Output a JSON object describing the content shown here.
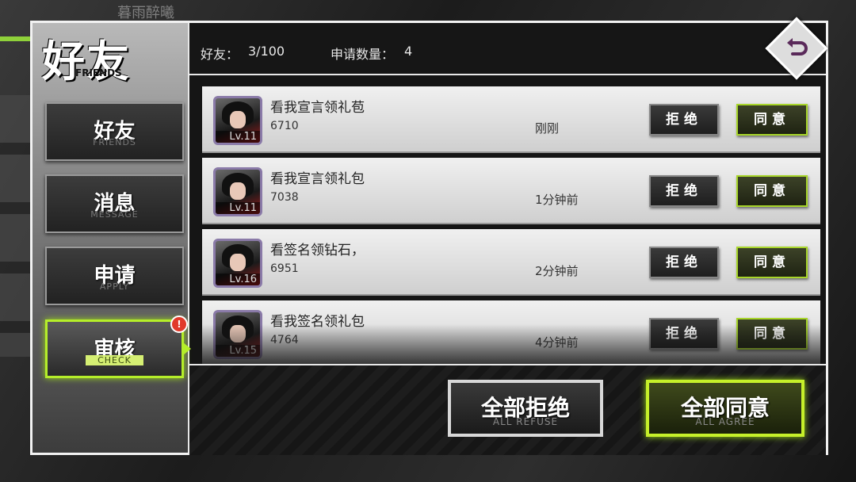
{
  "background": {
    "title": "暮雨醉曦"
  },
  "panel": {
    "title": "好友",
    "subtitle": "FRIENDS"
  },
  "nav": [
    {
      "label": "好友",
      "en": "FRIENDS",
      "active": false
    },
    {
      "label": "消息",
      "en": "MESSAGE",
      "active": false
    },
    {
      "label": "申请",
      "en": "APPLY",
      "active": false
    },
    {
      "label": "审核",
      "en": "CHECK",
      "active": true,
      "badge": "!"
    }
  ],
  "header": {
    "friends_label": "好友：",
    "friends_count": "3/100",
    "requests_label": "申请数量：",
    "requests_count": "4"
  },
  "requests": [
    {
      "name": "看我宣言领礼苞",
      "uid": "6710",
      "time": "刚刚",
      "level": "Lv.11"
    },
    {
      "name": "看我宣言领礼包",
      "uid": "7038",
      "time": "1分钟前",
      "level": "Lv.11"
    },
    {
      "name": "看签名领钻石，",
      "uid": "6951",
      "time": "2分钟前",
      "level": "Lv.16"
    },
    {
      "name": "看我签名领礼包",
      "uid": "4764",
      "time": "4分钟前",
      "level": "Lv.15"
    }
  ],
  "row_buttons": {
    "refuse": "拒绝",
    "agree": "同意"
  },
  "footer": {
    "refuse_all": "全部拒绝",
    "refuse_all_en": "ALL REFUSE",
    "agree_all": "全部同意",
    "agree_all_en": "ALL AGREE"
  },
  "colors": {
    "accent": "#b5ee2a",
    "badge": "#e13a2a"
  }
}
